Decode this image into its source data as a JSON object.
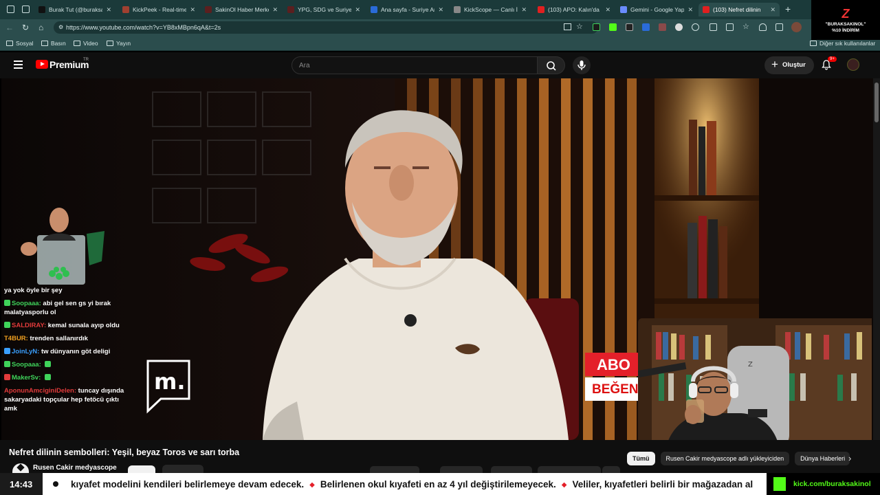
{
  "browser": {
    "tabs": [
      {
        "label": "Burak Tut (@buraksakinol)",
        "color": "#111111"
      },
      {
        "label": "KickPeek - Real-time UI",
        "color": "#a04030"
      },
      {
        "label": "SakinOl Haber Merkezi",
        "color": "#5b1f1f"
      },
      {
        "label": "YPG, SDG ve Suriye Sav",
        "color": "#5b1f1f"
      },
      {
        "label": "Ana sayfa - Suriye Arap",
        "color": "#2a6bd8"
      },
      {
        "label": "KickScope — Canlı İzle",
        "color": "#888888"
      },
      {
        "label": "(103) APO: Kalın'da",
        "color": "#e02020"
      },
      {
        "label": "Gemini - Google Yapay",
        "color": "#6a8cff"
      },
      {
        "label": "(103) Nefret dilinin",
        "color": "#e02020"
      }
    ],
    "url": "https://www.youtube.com/watch?v=YB8xMBpn6qA&t=2s",
    "bookmarks": [
      "Sosyal",
      "Basın",
      "Video",
      "Yayın"
    ],
    "other_bookmarks": "Diğer sık kullanılanlar"
  },
  "corner_logo": {
    "mark": "Z",
    "line1": "\"BURAKSAKINOL\"",
    "line2": "%10 İNDİRİM"
  },
  "youtube": {
    "brand": "Premium",
    "region": "TR",
    "search_placeholder": "Ara",
    "create_label": "Oluştur",
    "notification_count": "9+"
  },
  "chat": [
    {
      "user": "",
      "text": "ya yok öyle bir şey",
      "color": "#3fd35a",
      "badge": ""
    },
    {
      "user": "Soopaaa:",
      "text": "abi gel sen gs yi bırak malatyasporlu ol",
      "color": "#3fd35a",
      "badge": "#3fd35a"
    },
    {
      "user": "SALDIRAY:",
      "text": "kemal sunala ayıp oldu",
      "color": "#e23b3b",
      "badge": "#3fd35a"
    },
    {
      "user": "T4BUR:",
      "text": "trenden sallanırdık",
      "color": "#f0a020",
      "badge": ""
    },
    {
      "user": "JoinLyN:",
      "text": "tw dünyanın göt deligi",
      "color": "#3aa0ff",
      "badge": "#3aa0ff"
    },
    {
      "user": "Soopaaa:",
      "text": "",
      "color": "#3fd35a",
      "badge": "#3fd35a"
    },
    {
      "user": "MakerSv:",
      "text": "",
      "color": "#3fd35a",
      "badge": "#e23b3b"
    },
    {
      "user": "AponunAmciginiDelen:",
      "text": "tuncay dışında sakaryadaki topçular hep fetöcü çıktı amk",
      "color": "#e23b3b",
      "badge": ""
    }
  ],
  "overlay": {
    "abo_line1": "ABO",
    "abo_line2": "BEĞEN"
  },
  "video": {
    "title": "Nefret dilinin sembolleri: Yeşil, beyaz Toros ve sarı torba",
    "channel": "Rusen Cakir medyascope"
  },
  "chips": [
    "Tümü",
    "Rusen Cakir medyascope adlı yükleyiciden",
    "Dünya Haberleri"
  ],
  "ticker": {
    "time": "14:43",
    "items": [
      "kıyafet modelini kendileri belirlemeye devam edecek.",
      "Belirlenen okul kıyafeti en az 4 yıl değiştirilemeyecek.",
      "Veliler, kıyafetleri belirli bir mağazadan al"
    ],
    "kick_url": "kick.com/buraksakinol"
  }
}
